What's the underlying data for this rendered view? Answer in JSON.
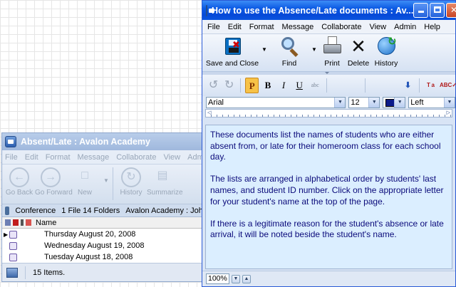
{
  "bg_window": {
    "title": "Absent/Late : Avalon Academy",
    "menu": [
      "File",
      "Edit",
      "Format",
      "Message",
      "Collaborate",
      "View",
      "Admin"
    ],
    "toolbar": {
      "go_back": "Go Back",
      "go_forward": "Go Forward",
      "new": "New",
      "history": "History",
      "summarize": "Summarize"
    },
    "infobar": {
      "location": "Conference",
      "counts": "1 File 14 Folders",
      "path": "Avalon Academy : John"
    },
    "list": {
      "column_name": "Name",
      "rows": [
        "Thursday August 20, 2008",
        "Wednesday August 19, 2008",
        "Tuesday August 18, 2008"
      ]
    },
    "status": "15 Items."
  },
  "fg_window": {
    "title": "How to use the Absence/Late documents : Av...",
    "menu": [
      "File",
      "Edit",
      "Format",
      "Message",
      "Collaborate",
      "View",
      "Admin",
      "Help"
    ],
    "toolbar": {
      "save_close": "Save and Close",
      "find": "Find",
      "print": "Print",
      "delete": "Delete",
      "history": "History"
    },
    "format_bar": {
      "paragraph": "P",
      "bold": "B",
      "italic": "I",
      "underline": "U"
    },
    "font_bar": {
      "font": "Arial",
      "size": "12",
      "color": "#0b1a8a",
      "align": "Left"
    },
    "document": {
      "paragraphs": [
        "These documents list the names of students who are either absent from, or late for their homeroom class for each school day.",
        "The lists are arranged in alphabetical order by students' last names, and student ID number. Click on the appropriate letter for your student's name at the top of the page.",
        "If there is a legitimate reason for the student's absence or late arrival, it will be noted beside the student's name."
      ]
    },
    "zoom": "100%"
  }
}
